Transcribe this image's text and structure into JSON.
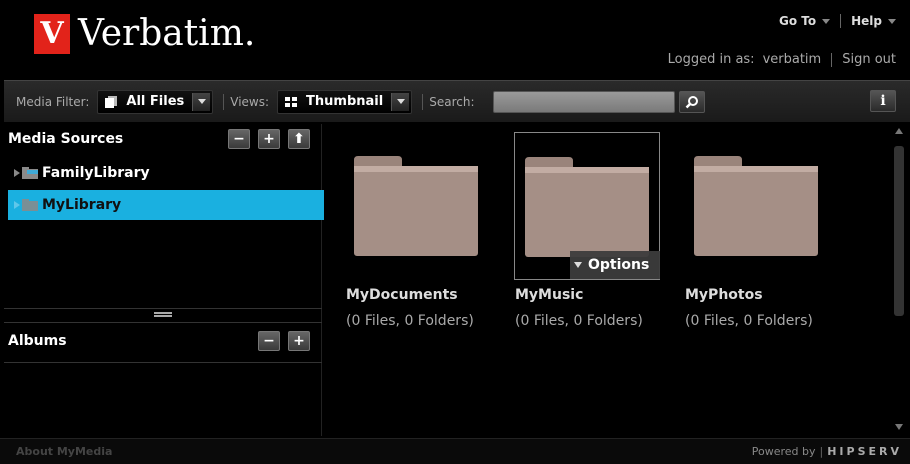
{
  "brand": {
    "logo_mark": "V",
    "logo_word": "Verbatim."
  },
  "top_menu": {
    "goto_label": "Go To",
    "help_label": "Help"
  },
  "login": {
    "logged_in_label": "Logged in as:",
    "username": "verbatim",
    "signout_label": "Sign out"
  },
  "toolbar": {
    "media_filter_label": "Media Filter:",
    "media_filter_value": "All Files",
    "views_label": "Views:",
    "views_value": "Thumbnail",
    "search_label": "Search:",
    "search_value": "",
    "info_label": "i"
  },
  "sidebar": {
    "media_sources_title": "Media Sources",
    "buttons": {
      "minus": "−",
      "plus": "+",
      "up": "⬆"
    },
    "items": [
      {
        "label": "FamilyLibrary",
        "selected": false
      },
      {
        "label": "MyLibrary",
        "selected": true
      }
    ],
    "albums_title": "Albums"
  },
  "content": {
    "folders": [
      {
        "name": "MyDocuments",
        "meta": "(0 Files, 0 Folders)",
        "selected": false
      },
      {
        "name": "MyMusic",
        "meta": "(0 Files, 0 Folders)",
        "selected": true
      },
      {
        "name": "MyPhotos",
        "meta": "(0 Files, 0 Folders)",
        "selected": false
      }
    ],
    "options_label": "Options"
  },
  "footer": {
    "about_label": "About MyMedia",
    "powered_label": "Powered by",
    "powered_brand": "HIPSERV"
  },
  "colors": {
    "selection": "#1ab0e0",
    "folder": "#a58f86",
    "logo_red": "#e2231a"
  }
}
